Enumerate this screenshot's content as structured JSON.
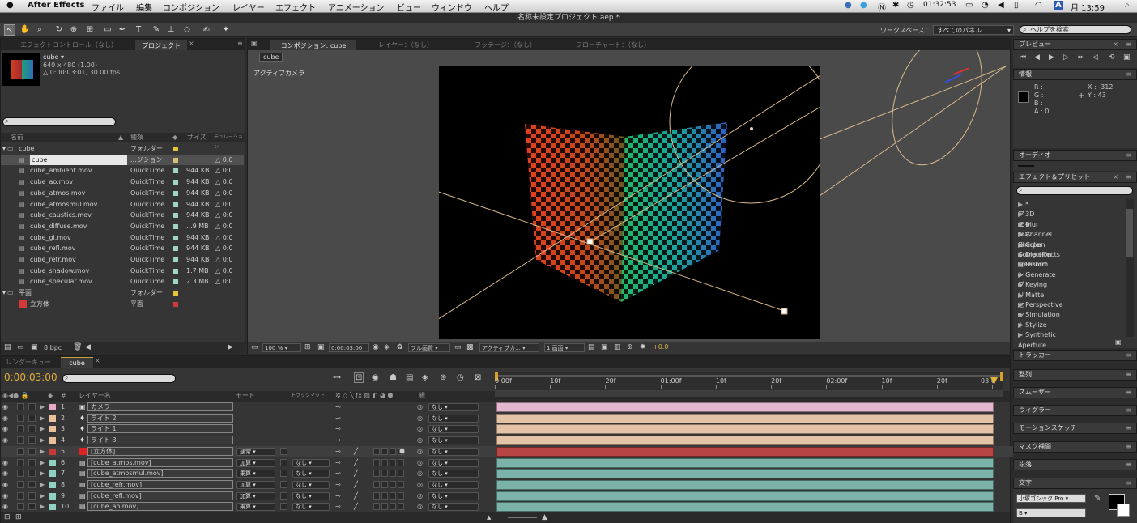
{
  "menubar": {
    "app": "After Effects",
    "items": [
      "ファイル",
      "編集",
      "コンポジション",
      "レイヤー",
      "エフェクト",
      "アニメーション",
      "ビュー",
      "ウィンドウ",
      "ヘルプ"
    ],
    "clock": "01:32:53",
    "day_time": "月 13:59",
    "input_mode": "A"
  },
  "window": {
    "title": "名称未設定プロジェクト.aep *"
  },
  "toolbar": {
    "workspace_label": "ワークスペース：",
    "workspace_value": "すべてのパネル",
    "help_placeholder": "ヘルプを検索"
  },
  "left_panel": {
    "tabs": [
      "エフェクトコントロール（なし）",
      "プロジェクト"
    ],
    "preview": {
      "name": "cube ▾",
      "size": "640 x 480 (1.00)",
      "duration": "△ 0:00:03:01, 30.00 fps"
    },
    "columns": [
      "名前",
      "種類",
      "サイズ",
      "デュレーション"
    ],
    "items": [
      {
        "name": "cube",
        "type": "フォルダー",
        "size": "",
        "dur": "",
        "color": "#e6c43a",
        "folder": true
      },
      {
        "name": "cube",
        "type": "...ジション",
        "size": "",
        "dur": "△ 0:0",
        "color": "#d9c07a",
        "selected": true
      },
      {
        "name": "cube_ambient.mov",
        "type": "QuickTime",
        "size": "944 KB",
        "dur": "△ 0:0",
        "color": "#9fd4c8"
      },
      {
        "name": "cube_ao.mov",
        "type": "QuickTime",
        "size": "944 KB",
        "dur": "△ 0:0",
        "color": "#9fd4c8"
      },
      {
        "name": "cube_atmos.mov",
        "type": "QuickTime",
        "size": "944 KB",
        "dur": "△ 0:0",
        "color": "#9fd4c8"
      },
      {
        "name": "cube_atmosmul.mov",
        "type": "QuickTime",
        "size": "944 KB",
        "dur": "△ 0:0",
        "color": "#9fd4c8"
      },
      {
        "name": "cube_caustics.mov",
        "type": "QuickTime",
        "size": "944 KB",
        "dur": "△ 0:0",
        "color": "#9fd4c8"
      },
      {
        "name": "cube_diffuse.mov",
        "type": "QuickTime",
        "size": "...9 MB",
        "dur": "△ 0:0",
        "color": "#9fd4c8"
      },
      {
        "name": "cube_gi.mov",
        "type": "QuickTime",
        "size": "944 KB",
        "dur": "△ 0:0",
        "color": "#9fd4c8"
      },
      {
        "name": "cube_refl.mov",
        "type": "QuickTime",
        "size": "944 KB",
        "dur": "△ 0:0",
        "color": "#9fd4c8"
      },
      {
        "name": "cube_refr.mov",
        "type": "QuickTime",
        "size": "944 KB",
        "dur": "△ 0:0",
        "color": "#9fd4c8"
      },
      {
        "name": "cube_shadow.mov",
        "type": "QuickTime",
        "size": "1.7 MB",
        "dur": "△ 0:0",
        "color": "#9fd4c8"
      },
      {
        "name": "cube_specular.mov",
        "type": "QuickTime",
        "size": "2.3 MB",
        "dur": "△ 0:0",
        "color": "#9fd4c8"
      },
      {
        "name": "平面",
        "type": "フォルダー",
        "size": "",
        "dur": "",
        "color": "#e6c43a",
        "folder": true
      },
      {
        "name": "立方体",
        "type": "平面",
        "size": "",
        "dur": "",
        "color": "#d23a3a",
        "solid": true
      }
    ],
    "bpc": "8 bpc"
  },
  "comp_panel": {
    "tabs": [
      "コンポジション: cube",
      "レイヤー：（なし）",
      "フッテージ：（なし）",
      "フローチャート：（なし）"
    ],
    "breadcrumb": "cube",
    "view_label": "アクティブカメラ",
    "zoom": "100 %",
    "time": "0:00:03:00",
    "resolution": "フル画質",
    "camera": "アクティブカ...",
    "views": "1 画面",
    "exposure": "+0.0"
  },
  "right_panel": {
    "preview_tab": "プレビュー",
    "info_tab": "情報",
    "info": {
      "r": "R :",
      "g": "G :",
      "b": "B :",
      "a": "A : 0",
      "x": "X : -312",
      "y": "Y : 43"
    },
    "audio_tab": "オーディオ",
    "effects_tab": "エフェクト＆プリセット",
    "effects": [
      "* アニメーションプリセット",
      "3Dチャンネル",
      "Blur & Sharpen",
      "Channel",
      "Color Correction",
      "Digieffects FreeForm",
      "Distort",
      "Generate",
      "Keying",
      "Matte",
      "Perspective",
      "Simulation",
      "Stylize",
      "Synthetic Aperture"
    ],
    "collapsed_tabs": [
      "トラッカー",
      "整列",
      "スムーザー",
      "ウィグラー",
      "モーションスケッチ",
      "マスク補間",
      "段落"
    ],
    "char_tab": "文字",
    "font": "小塚ゴシック Pro",
    "style": "B"
  },
  "timeline": {
    "tabs": [
      "レンダーキュー",
      "cube"
    ],
    "time": "0:00:03:00",
    "columns": {
      "layer_name": "レイヤー名",
      "mode": "モード",
      "t": "T",
      "trkmat": "トラックマット",
      "parent": "親"
    },
    "ruler": [
      "0:00f",
      "10f",
      "20f",
      "01:00f",
      "10f",
      "20f",
      "02:00f",
      "10f",
      "20f",
      "03:0"
    ],
    "playhead_fraction": 1.0,
    "layers": [
      {
        "num": "1",
        "name": "カメラ",
        "type": "camera",
        "label": "#e7a9c8",
        "mode": "",
        "trk": "",
        "parent": "なし",
        "bar": "#e3b8cf"
      },
      {
        "num": "2",
        "name": "ライト 2",
        "type": "light",
        "label": "#e8c09c",
        "mode": "",
        "trk": "",
        "parent": "なし",
        "bar": "#e4c3a6"
      },
      {
        "num": "3",
        "name": "ライト 1",
        "type": "light",
        "label": "#e8c09c",
        "mode": "",
        "trk": "",
        "parent": "なし",
        "bar": "#e4c3a6"
      },
      {
        "num": "4",
        "name": "ライト 3",
        "type": "light",
        "label": "#e8c09c",
        "mode": "",
        "trk": "",
        "parent": "なし",
        "bar": "#e4c3a6"
      },
      {
        "num": "5",
        "name": "[立方体]",
        "type": "solid",
        "label": "#c83a3a",
        "mode": "通常",
        "trk": "",
        "parent": "なし",
        "bar": "#b84545"
      },
      {
        "num": "6",
        "name": "[cube_atmos.mov]",
        "type": "footage",
        "label": "#8fcfc4",
        "mode": "加算",
        "trk": "なし",
        "parent": "なし",
        "bar": "#7bb3aa"
      },
      {
        "num": "7",
        "name": "[cube_atmosmul.mov]",
        "type": "footage",
        "label": "#8fcfc4",
        "mode": "乗算",
        "trk": "なし",
        "parent": "なし",
        "bar": "#7bb3aa"
      },
      {
        "num": "8",
        "name": "[cube_refr.mov]",
        "type": "footage",
        "label": "#8fcfc4",
        "mode": "加算",
        "trk": "なし",
        "parent": "なし",
        "bar": "#7bb3aa"
      },
      {
        "num": "9",
        "name": "[cube_refl.mov]",
        "type": "footage",
        "label": "#8fcfc4",
        "mode": "加算",
        "trk": "なし",
        "parent": "なし",
        "bar": "#7bb3aa"
      },
      {
        "num": "10",
        "name": "[cube_ao.mov]",
        "type": "footage",
        "label": "#8fcfc4",
        "mode": "乗算",
        "trk": "なし",
        "parent": "なし",
        "bar": "#7bb3aa"
      }
    ]
  }
}
